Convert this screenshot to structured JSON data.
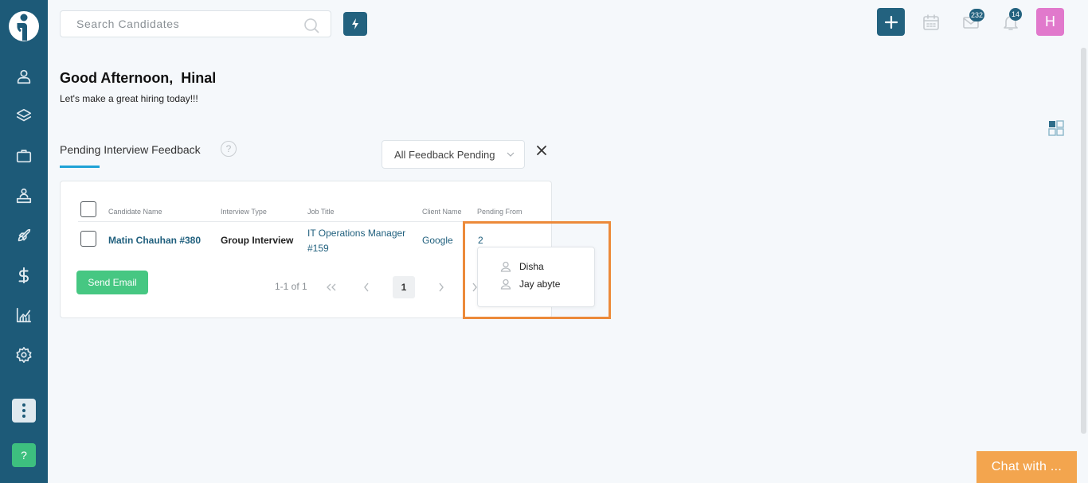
{
  "header": {
    "search_placeholder": "Search Candidates",
    "messages_count": "232",
    "notifications_count": "14",
    "avatar_initial": "H",
    "accent_color": "#23627f",
    "avatar_color": "#e179cc"
  },
  "sidebar": {
    "background": "#1d5a78",
    "items": [
      {
        "icon": "candidates-icon"
      },
      {
        "icon": "layers-icon"
      },
      {
        "icon": "jobs-briefcase-icon"
      },
      {
        "icon": "clients-org-icon"
      },
      {
        "icon": "rocket-icon"
      },
      {
        "icon": "dollar-icon"
      },
      {
        "icon": "analytics-icon"
      },
      {
        "icon": "settings-gear-icon"
      }
    ],
    "help_label": "?"
  },
  "greeting": {
    "title": "Good Afternoon,  Hinal",
    "subtitle": "Let's make a great hiring today!!!"
  },
  "widget": {
    "title": "Pending Interview Feedback",
    "help_label": "?",
    "filter_value": "All Feedback Pending",
    "columns": [
      "Candidate Name",
      "Interview Type",
      "Job Title",
      "Client Name",
      "Pending From"
    ],
    "rows": [
      {
        "candidate": "Matin Chauhan #380",
        "interview_type": "Group Interview",
        "job_title_line1": "IT Operations Manager",
        "job_title_line2": "#159",
        "client": "Google",
        "pending_from": "2"
      }
    ],
    "send_email_label": "Send Email",
    "pagination_info": "1-1 of 1",
    "current_page": "1",
    "popover_names": [
      "Disha",
      "Jay abyte"
    ]
  },
  "chat": {
    "label": "Chat with ...",
    "color": "#f3a54e"
  }
}
